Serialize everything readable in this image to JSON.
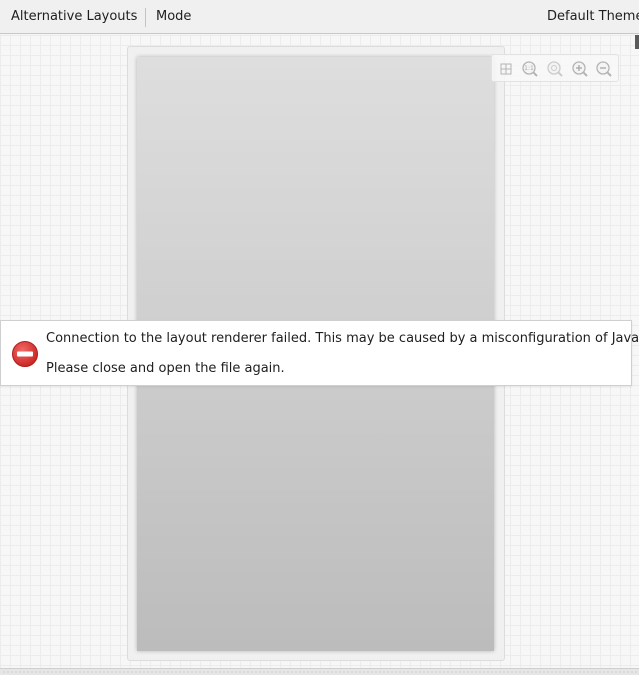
{
  "toolbar": {
    "alternative_layouts": "Alternative Layouts",
    "mode": "Mode",
    "theme": "Default Theme"
  },
  "zoom_controls": [
    {
      "name": "fit-screen-icon"
    },
    {
      "name": "actual-size-icon"
    },
    {
      "name": "zoom-reset-icon"
    },
    {
      "name": "zoom-in-icon"
    },
    {
      "name": "zoom-out-icon"
    }
  ],
  "error": {
    "icon": "error-stop-icon",
    "icon_color": "#d9322f",
    "line1": "Connection to the layout renderer failed. This may be caused by a misconfiguration of Java",
    "line2": "Please close and open the file again."
  },
  "colors": {
    "toolbar_bg": "#f0f0f0",
    "canvas_bg": "#f7f7f7",
    "device_screen": "#cfcfcf",
    "error_red": "#d9322f"
  }
}
